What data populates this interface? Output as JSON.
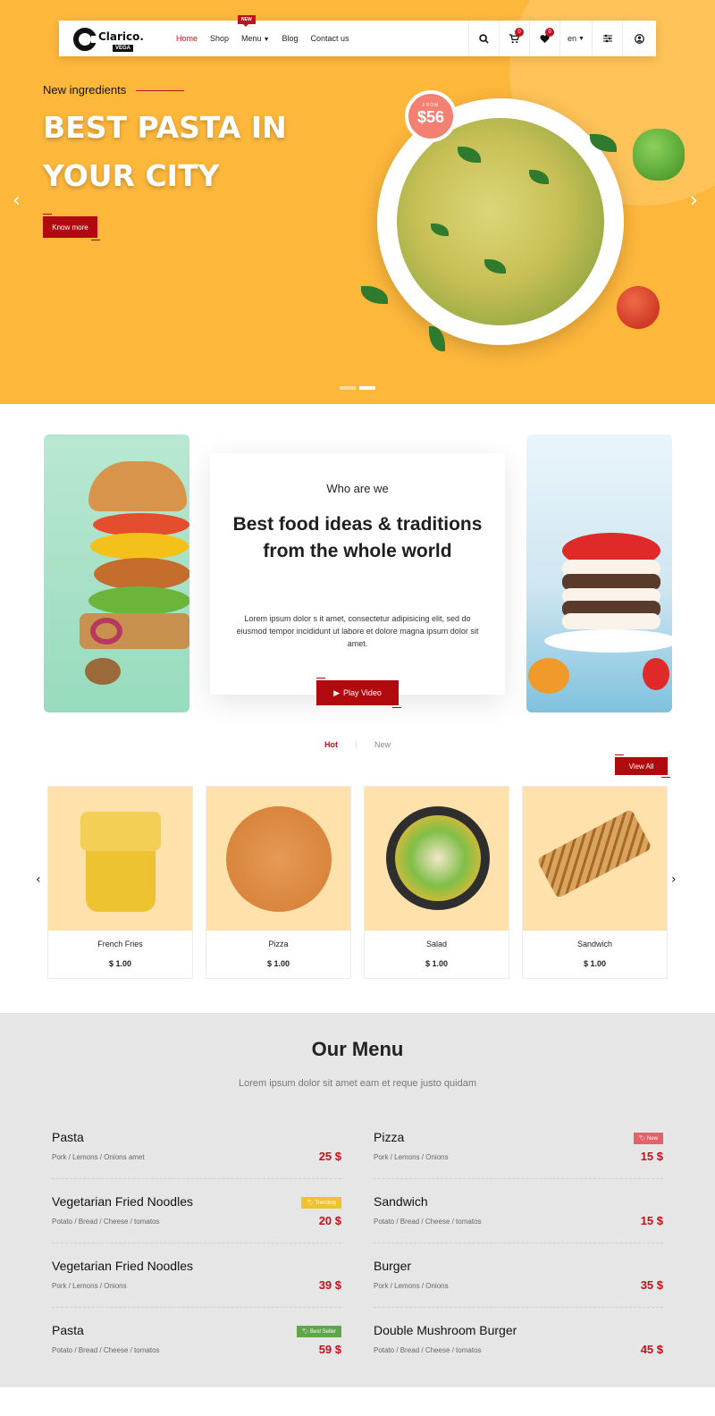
{
  "header": {
    "logo_text": "Clarico.",
    "logo_sub": "VEGA",
    "nav": [
      {
        "label": "Home",
        "active": true
      },
      {
        "label": "Shop"
      },
      {
        "label": "Menu",
        "badge": "NEW",
        "has_dropdown": true
      },
      {
        "label": "Blog"
      },
      {
        "label": "Contact us"
      }
    ],
    "cart_count": "0",
    "wishlist_count": "0",
    "language": "en",
    "icons": [
      "search-icon",
      "cart-icon",
      "heart-icon",
      "language-select",
      "filter-icon",
      "user-icon"
    ]
  },
  "hero": {
    "kicker": "New ingredients",
    "title": "BEST PASTA IN YOUR CITY",
    "button": "Know more",
    "price_label": "FROM",
    "price": "$56",
    "slides": 2,
    "active_slide": 2,
    "colors": {
      "background": "#fdb73b",
      "accent": "#b00a0f"
    }
  },
  "about": {
    "kicker": "Who are we",
    "title": "Best food ideas & traditions from the whole world",
    "text": "Lorem ipsum dolor s it amet, consectetur adipisicing elit, sed do eiusmod tempor incididunt ut labore et dolore magna ipsum dolor sit amet.",
    "button": "Play Video"
  },
  "products": {
    "tabs": [
      "Hot",
      "New"
    ],
    "active_tab": "Hot",
    "view_all": "View All",
    "items": [
      {
        "name": "French Fries",
        "price": "$ 1.00"
      },
      {
        "name": "Pizza",
        "price": "$ 1.00"
      },
      {
        "name": "Salad",
        "price": "$ 1.00"
      },
      {
        "name": "Sandwich",
        "price": "$ 1.00"
      }
    ]
  },
  "menu": {
    "title": "Our Menu",
    "subtitle": "Lorem ipsum dolor sit amet eam et reque justo quidam",
    "left": [
      {
        "name": "Pasta",
        "desc": "Pork / Lemons / Onions amet",
        "price": "25 $"
      },
      {
        "name": "Vegetarian Fried Noodles",
        "desc": "Potato / Bread / Cheese / tomatos",
        "price": "20 $",
        "badge": "Trending",
        "badge_color": "#f0c230"
      },
      {
        "name": "Vegetarian Fried Noodles",
        "desc": "Pork / Lemons / Onions",
        "price": "39 $"
      },
      {
        "name": "Pasta",
        "desc": "Potato / Bread / Cheese / tomatos",
        "price": "59 $",
        "badge": "Best Seller",
        "badge_color": "#5fa64a"
      }
    ],
    "right": [
      {
        "name": "Pizza",
        "desc": "Pork / Lemons / Onions",
        "price": "15 $",
        "badge": "New",
        "badge_color": "#e2636a"
      },
      {
        "name": "Sandwich",
        "desc": "Potato / Bread / Cheese / tomatos",
        "price": "15 $"
      },
      {
        "name": "Burger",
        "desc": "Pork / Lemons / Onions",
        "price": "35 $"
      },
      {
        "name": "Double Mushroom Burger",
        "desc": "Potato / Bread / Cheese / tomatos",
        "price": "45 $"
      }
    ]
  }
}
